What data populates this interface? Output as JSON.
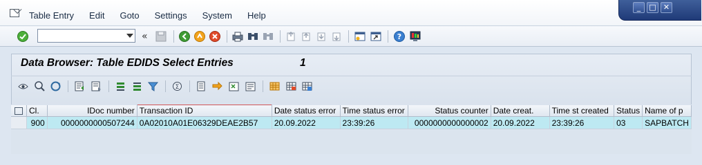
{
  "menu": {
    "items": [
      "Table Entry",
      "Edit",
      "Goto",
      "Settings",
      "System",
      "Help"
    ]
  },
  "window_controls": {
    "minimize": "_",
    "restore": "□",
    "close": "✕"
  },
  "toolbar": {
    "command_field_value": "",
    "nav_chevron": "«"
  },
  "title": {
    "text": "Data Browser: Table EDIDS Select Entries",
    "count": "1"
  },
  "grid": {
    "columns": [
      "Cl.",
      "IDoc number",
      "Transaction ID",
      "Date status error",
      "Time status error",
      "Status counter",
      "Date creat.",
      "Time st created",
      "Status",
      "Name of p"
    ],
    "rows": [
      [
        "900",
        "0000000000507244",
        "0A02010A01E06329DEAE2B57",
        "20.09.2022",
        "23:39:26",
        "0000000000000002",
        "20.09.2022",
        "23:39:26",
        "03",
        "SAPBATCH"
      ]
    ]
  },
  "colors": {
    "key_cell": "#a8dde8",
    "row_cell": "#bde9f2",
    "selected_cell": "#fdd08d",
    "title_bar": "#dde6f1",
    "window_controls": "#2f4f90"
  }
}
